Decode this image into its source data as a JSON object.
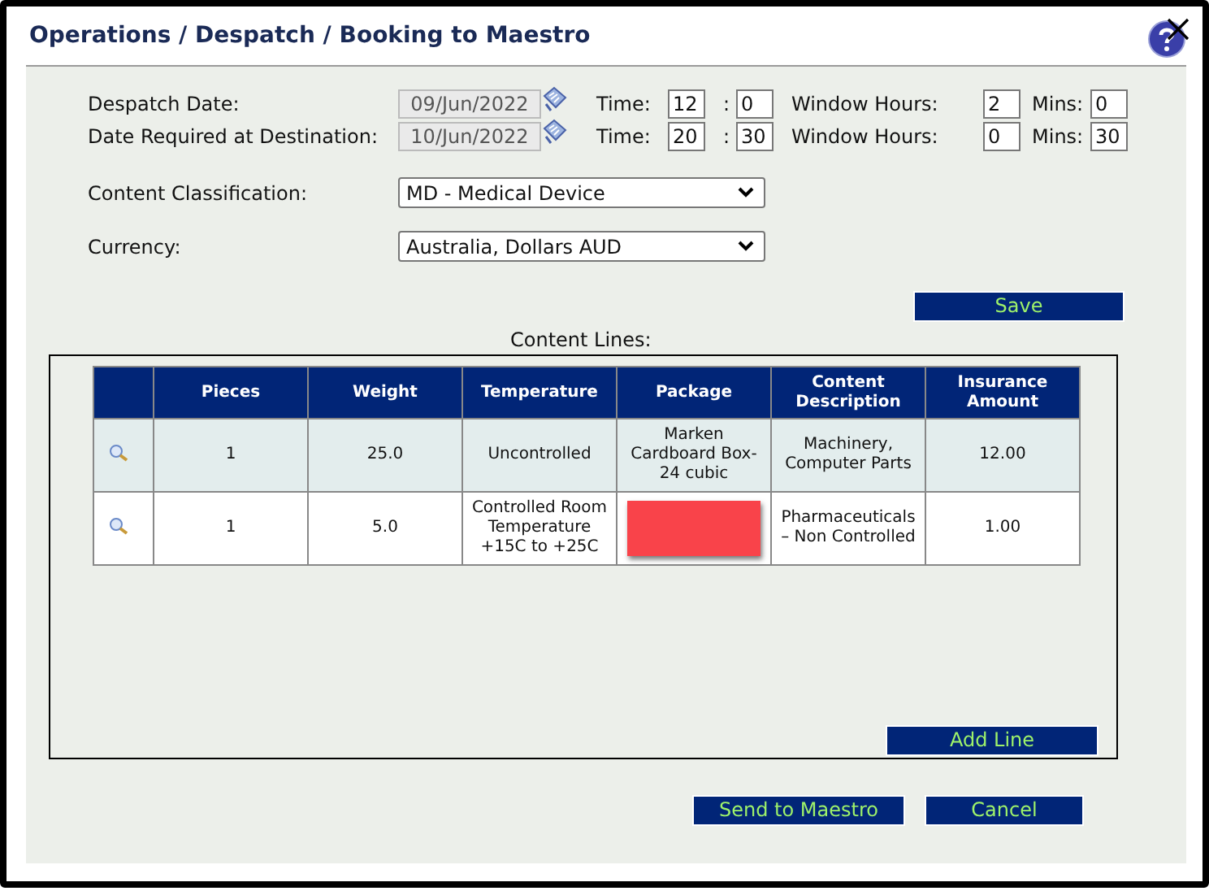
{
  "window": {
    "title": "Operations / Despatch / Booking to Maestro"
  },
  "schedule": [
    {
      "label": "Despatch Date:",
      "date": "09/Jun/2022",
      "time_label": "Time:",
      "hour": "12",
      "separator": ":",
      "minute": "0",
      "window_label": "Window Hours:",
      "window_hours": "2",
      "mins_label": "Mins:",
      "window_mins": "0"
    },
    {
      "label": "Date Required at Destination:",
      "date": "10/Jun/2022",
      "time_label": "Time:",
      "hour": "20",
      "separator": ":",
      "minute": "30",
      "window_label": "Window Hours:",
      "window_hours": "0",
      "mins_label": "Mins:",
      "window_mins": "30"
    }
  ],
  "selects": [
    {
      "label": "Content Classification:",
      "value": "MD - Medical Device"
    },
    {
      "label": "Currency:",
      "value": "Australia, Dollars AUD"
    }
  ],
  "save_button": "Save",
  "content_lines": {
    "title": "Content Lines:",
    "columns": [
      "Pieces",
      "Weight",
      "Temperature",
      "Package",
      "Content Description",
      "Insurance Amount"
    ],
    "rows": [
      {
        "shaded": true,
        "cells": [
          {
            "kind": "text",
            "text": "1"
          },
          {
            "kind": "text",
            "text": "25.0"
          },
          {
            "kind": "text",
            "text": "Uncontrolled"
          },
          {
            "kind": "text",
            "text": "Marken Cardboard Box-24 cubic"
          },
          {
            "kind": "text",
            "text": "Machinery, Computer Parts"
          },
          {
            "kind": "text",
            "text": "12.00"
          }
        ]
      },
      {
        "shaded": false,
        "cells": [
          {
            "kind": "text",
            "text": "1"
          },
          {
            "kind": "text",
            "text": "5.0"
          },
          {
            "kind": "text",
            "text": "Controlled Room Temperature +15C to +25C"
          },
          {
            "kind": "redacted"
          },
          {
            "kind": "text",
            "text": "Pharmaceuticals – Non Controlled"
          },
          {
            "kind": "text",
            "text": "1.00"
          }
        ]
      }
    ],
    "add_button": "Add Line"
  },
  "buttons": [
    "Send to Maestro",
    "Cancel"
  ]
}
